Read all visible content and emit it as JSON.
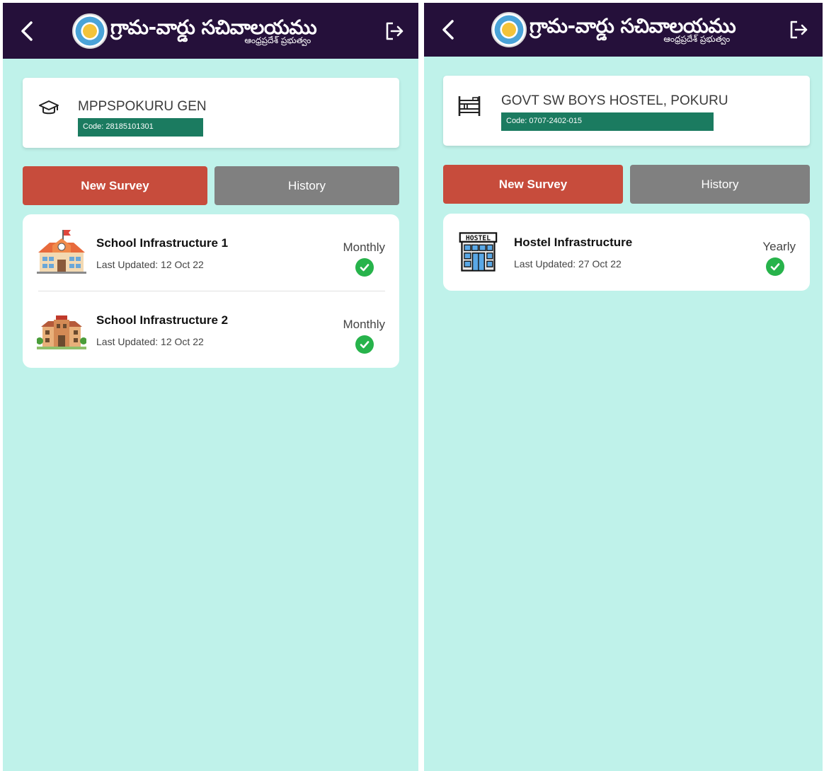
{
  "brand": {
    "title": "గ్రామ-వార్డు సచివాలయము",
    "subtitle": "ఆంధ్రప్రదేశ్ ప్రభుత్వం"
  },
  "icons": {
    "back": "chevron-left-icon",
    "logout": "logout-arrow-icon",
    "emblem": "state-emblem-icon",
    "school": "graduation-cap-icon",
    "hostel": "bunk-bed-icon",
    "check": "check-circle-icon"
  },
  "colors": {
    "appbar": "#25103a",
    "background": "#bff2ea",
    "code_bar": "#1b7b60",
    "new_survey": "#c74c3c",
    "history": "#808080",
    "check": "#27b34b"
  },
  "left": {
    "institution": {
      "name": "MPPSPOKURU GEN",
      "code": "Code: 28185101301"
    },
    "tabs": {
      "new_survey": "New Survey",
      "history": "History"
    },
    "surveys": [
      {
        "title": "School Infrastructure 1",
        "updated": "Last Updated: 12 Oct 22",
        "frequency": "Monthly"
      },
      {
        "title": "School Infrastructure 2",
        "updated": "Last Updated: 12 Oct 22",
        "frequency": "Monthly"
      }
    ]
  },
  "right": {
    "institution": {
      "name": "GOVT SW BOYS HOSTEL, POKURU",
      "code": "Code: 0707-2402-015"
    },
    "tabs": {
      "new_survey": "New Survey",
      "history": "History"
    },
    "surveys": [
      {
        "title": "Hostel Infrastructure",
        "updated": "Last Updated: 27 Oct 22",
        "frequency": "Yearly",
        "sign": "HOSTEL"
      }
    ]
  }
}
